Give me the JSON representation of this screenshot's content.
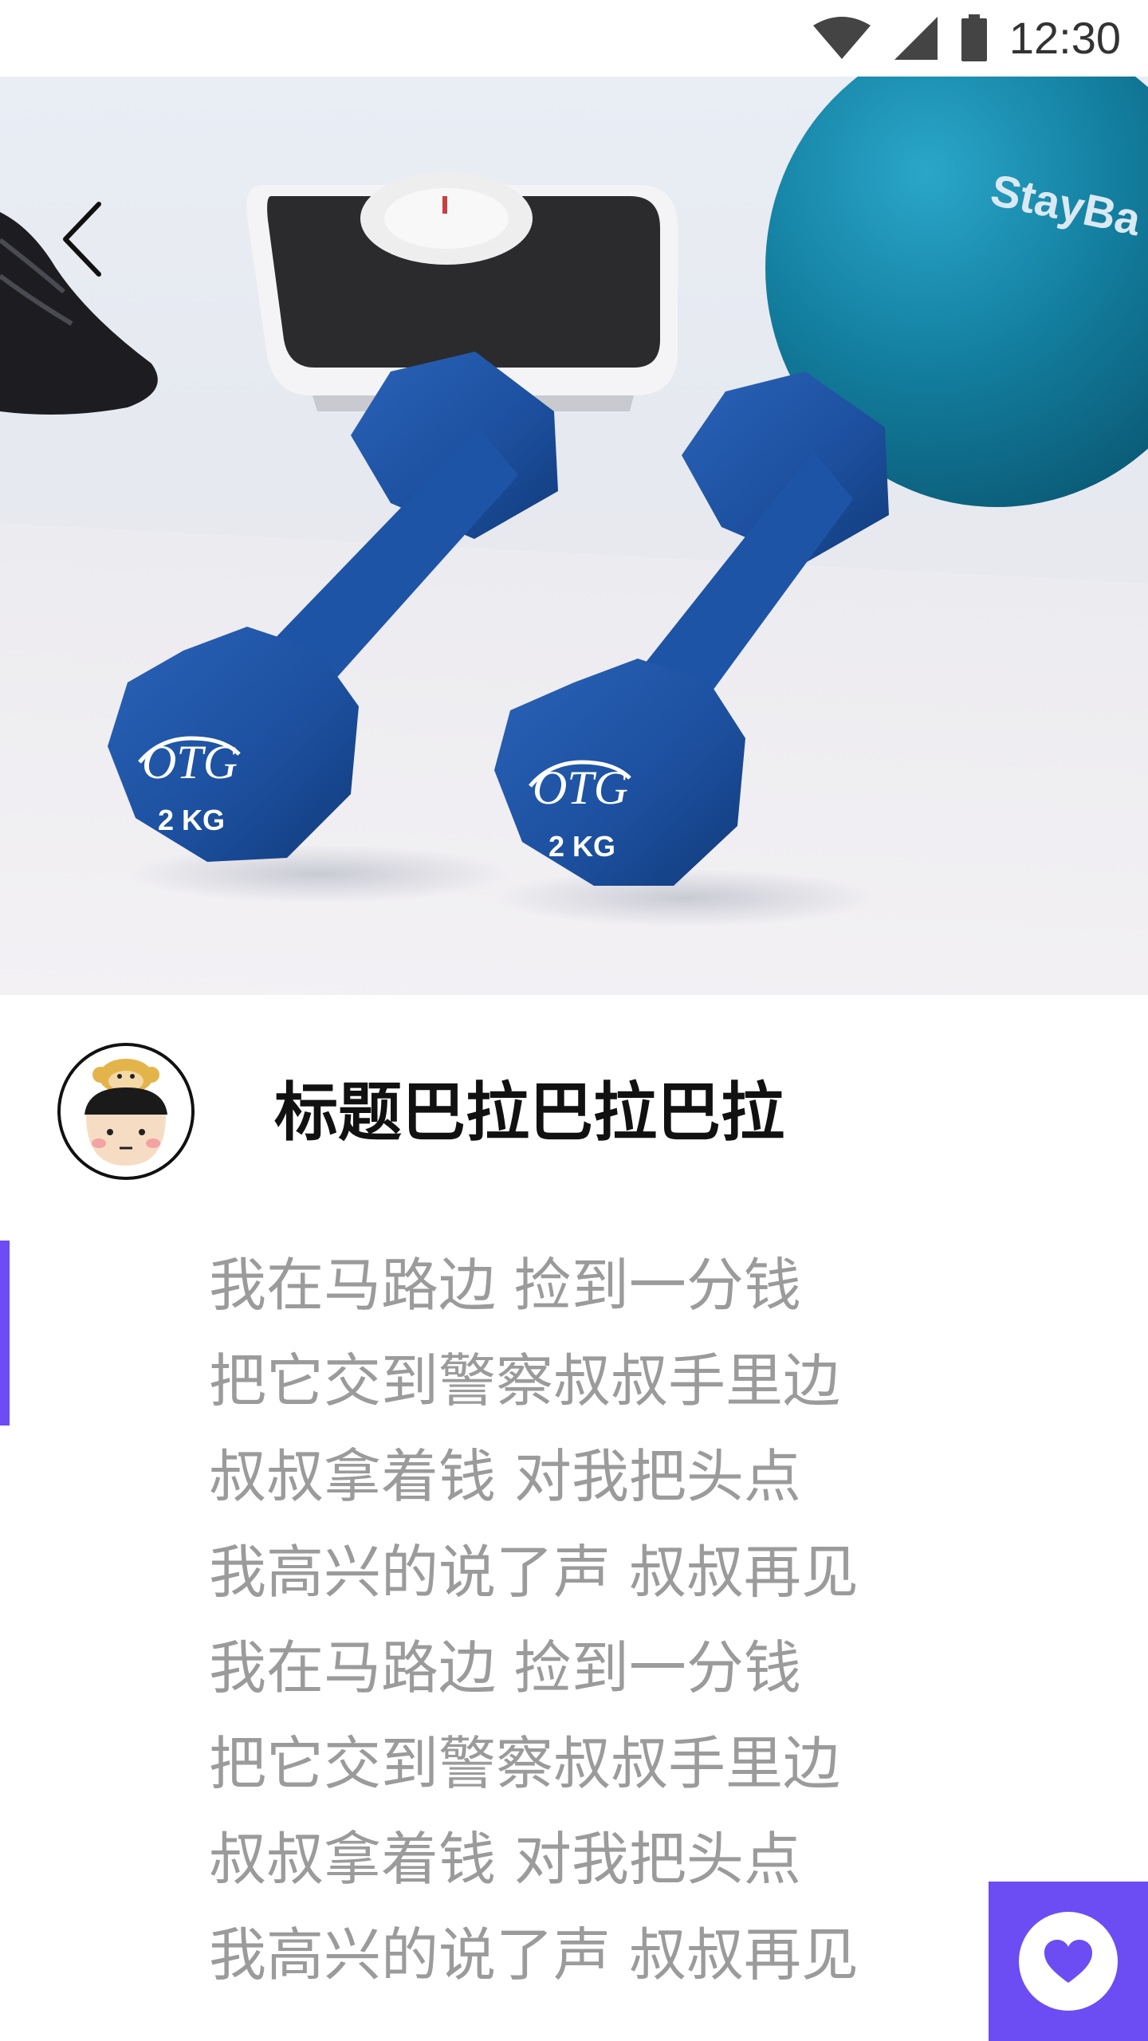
{
  "status_bar": {
    "time": "12:30",
    "icons": [
      "wifi-icon",
      "cell-signal-icon",
      "battery-icon"
    ]
  },
  "hero": {
    "image": "fitness-dumbbells-photo",
    "back_icon": "chevron-left-icon",
    "ball_text": "StayBa",
    "dumbbell_brand": "OTG",
    "dumbbell_weight": "2 KG"
  },
  "article": {
    "avatar": "avatar",
    "title": "标题巴拉巴拉巴拉",
    "lines": [
      "我在马路边 捡到一分钱",
      "把它交到警察叔叔手里边",
      "叔叔拿着钱 对我把头点",
      "我高兴的说了声 叔叔再见",
      "我在马路边 捡到一分钱",
      "把它交到警察叔叔手里边",
      "叔叔拿着钱 对我把头点",
      "我高兴的说了声 叔叔再见"
    ]
  },
  "fab": {
    "icon": "heart-icon"
  },
  "colors": {
    "accent": "#6c4cf3",
    "title": "#111111",
    "body_text": "#9b9b9b",
    "dumbbell": "#1c4f9e"
  }
}
